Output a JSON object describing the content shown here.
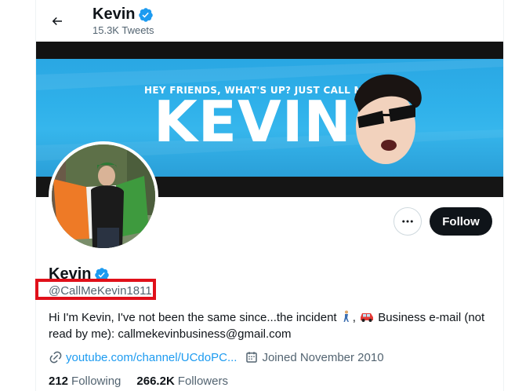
{
  "header": {
    "name": "Kevin",
    "tweets_count": "15.3K Tweets"
  },
  "banner": {
    "tagline": "HEY FRIENDS, WHAT'S UP? JUST CALL ME",
    "big_text": "KEVIN"
  },
  "profile": {
    "name": "Kevin",
    "handle": "@CallMeKevin1811",
    "bio_text": "Hi I'm Kevin, I've not been the same since...the incident",
    "bio_business": "Business e-mail (not read by me): callmekevinbusiness@gmail.com",
    "link": "youtube.com/channel/UCdoPC...",
    "joined": "Joined November 2010"
  },
  "actions": {
    "follow_label": "Follow"
  },
  "stats": {
    "following_count": "212",
    "following_label": "Following",
    "followers_count": "266.2K",
    "followers_label": "Followers"
  },
  "colors": {
    "accent": "#1d9bf0",
    "verified": "#1d9bf0",
    "highlight_box": "#e0101a"
  },
  "icons": [
    "back-arrow-icon",
    "verified-badge-icon",
    "more-icon",
    "link-icon",
    "calendar-icon",
    "person-walking-emoji",
    "car-emoji"
  ]
}
